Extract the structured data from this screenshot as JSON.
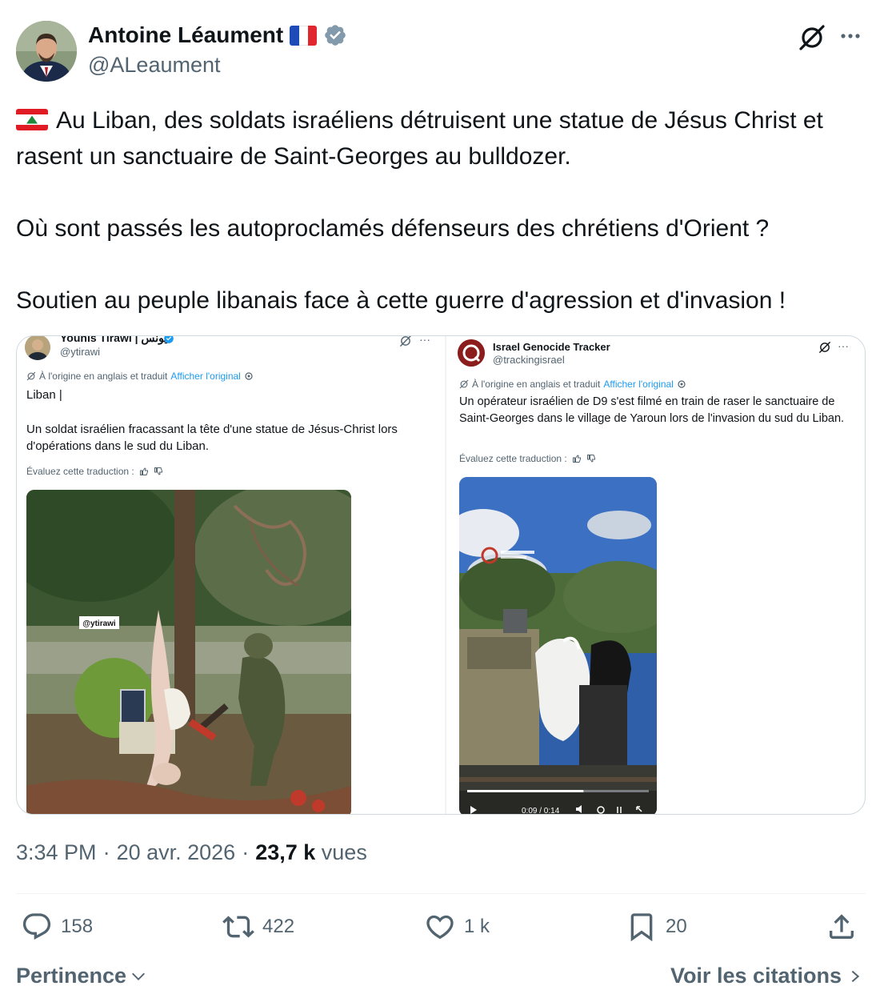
{
  "author": {
    "name": "Antoine Léaument",
    "handle": "@ALeaument"
  },
  "icons": {
    "grok": "grok-icon",
    "more": "more-icon",
    "verified": "verified-badge-icon"
  },
  "tweet": {
    "line1": "Au Liban, des soldats israéliens détruisent une statue de Jésus Christ et rasent un sanctuaire de Saint-Georges au bulldozer.",
    "line2": "Où sont passés les autoproclamés défenseurs des chrétiens d'Orient ?",
    "line3": "Soutien au peuple libanais face à cette guerre d'agression et d'invasion !"
  },
  "media": {
    "left": {
      "name": "Younis Tirawi | يونس",
      "handle": "@ytirawi",
      "translated_label": "À l'origine en anglais et traduit",
      "show_original": "Afficher l'original",
      "body_title": "Liban |",
      "body_text": "Un soldat israélien fracassant la tête d'une statue de Jésus-Christ lors d'opérations dans le sud du Liban.",
      "rate_label": "Évaluez cette traduction :",
      "watermark": "@ytirawi"
    },
    "right": {
      "name": "Israel Genocide Tracker",
      "handle": "@trackingisrael",
      "translated_label": "À l'origine en anglais et traduit",
      "show_original": "Afficher l'original",
      "body_text": "Un opérateur israélien de D9 s'est filmé en train de raser le sanctuaire de Saint-Georges dans le village de Yaroun lors de l'invasion du sud du Liban.",
      "rate_label": "Évaluez cette traduction :",
      "video_time": "0:09 / 0:14",
      "video_progress": 0.64
    }
  },
  "meta": {
    "time": "3:34 PM",
    "dot1": "·",
    "date": "20 avr. 2026",
    "dot2": "·",
    "views_count": "23,7 k",
    "views_label": "vues"
  },
  "actions": {
    "replies": "158",
    "reposts": "422",
    "likes": "1 k",
    "bookmarks": "20"
  },
  "footer": {
    "sort_label": "Pertinence",
    "quotes_link": "Voir les citations"
  },
  "colors": {
    "text": "#0f1419",
    "secondary": "#536471",
    "link": "#1d9bf0",
    "verified": "#829aab",
    "border": "#cfd9de"
  }
}
